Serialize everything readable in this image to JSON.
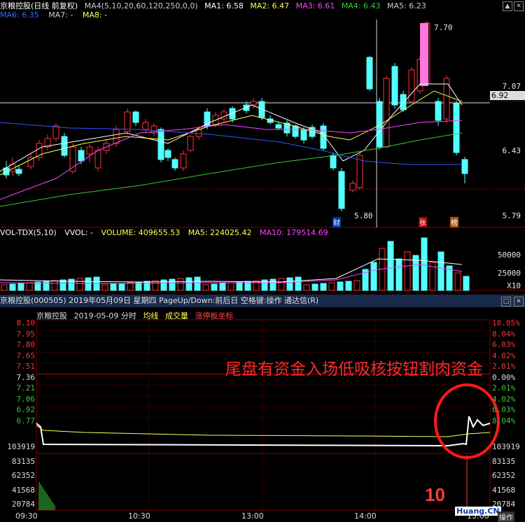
{
  "kline": {
    "legend_top": {
      "title": "京粮控股(日线 前复权)",
      "ma4": "MA4(5,10,20,60,120,250,0,0)",
      "ma1": "MA1: 6.58",
      "ma2": "MA2: 6.47",
      "ma3": "MA3: 6.61",
      "ma4v": "MA4: 6.43",
      "ma5": "MA5: 6.23"
    },
    "legend_2": {
      "ma6": "MA6: 6.35",
      "ma7": "MA7: -",
      "ma8": "MA8: -"
    },
    "price_labels": [
      "7.70",
      "7.07",
      "6.92",
      "6.43",
      "5.80",
      "5.79"
    ],
    "badges": [
      "财",
      "张",
      "榜"
    ],
    "colors": {
      "up": "#ff3333",
      "down": "#54ffff",
      "ma_white": "#ffffff",
      "ma_yellow": "#ffff55",
      "ma_magenta": "#ff44ff",
      "ma_green": "#33cc33",
      "ma_blue": "#3355ff"
    }
  },
  "volume": {
    "legend": {
      "name": "VOL-TDX(5,10)",
      "vvol": "VVOL: -",
      "volume": "VOLUME: 409655.53",
      "ma5": "MA5: 224025.42",
      "ma10": "MA10: 179514.69"
    },
    "axis": [
      "50000",
      "25000",
      "X10"
    ]
  },
  "intraday": {
    "titlebar": "京粮控股(000505)  2019年05月09日 星期四  PageUp/Down:前后日  空格键:操作  通达信(R)",
    "subtitle": {
      "name": "京粮控股",
      "date": "2019-05-09 分时",
      "l1": "均线",
      "l2": "成交量",
      "l3": "涨停板坐标"
    },
    "left_axis": [
      "8.10",
      "7.95",
      "7.80",
      "7.65",
      "7.51",
      "7.36",
      "7.21",
      "7.06",
      "6.92",
      "6.77",
      "103919",
      "83135",
      "62352",
      "41568",
      "20784"
    ],
    "right_axis": [
      "10.05%",
      "8.04%",
      "6.03%",
      "4.02%",
      "2.01%",
      "0.00%",
      "2.01%",
      "4.02%",
      "6.03%",
      "8.04%",
      "103919",
      "83135",
      "62352",
      "41568",
      "20784"
    ],
    "times": [
      "09:30",
      "10:30",
      "13:00",
      "14:00",
      "15:00"
    ],
    "annotation": "尾盘有资金入场低吸核按钮割肉资金",
    "brand": "10",
    "brand_site": "Huang.CN",
    "op_label": "操作"
  }
}
